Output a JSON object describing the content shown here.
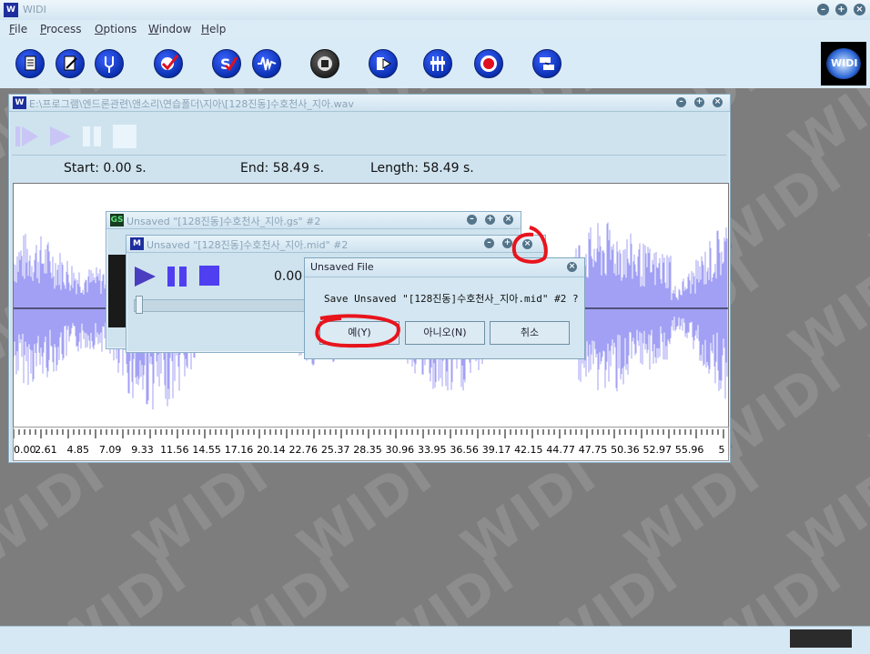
{
  "app": {
    "title": "WIDI",
    "logo_text": "WIDI"
  },
  "menu": [
    {
      "label": "File",
      "mnemonic": "F",
      "rest": "ile"
    },
    {
      "label": "Process",
      "mnemonic": "P",
      "rest": "rocess"
    },
    {
      "label": "Options",
      "mnemonic": "O",
      "rest": "ptions"
    },
    {
      "label": "Window",
      "mnemonic": "W",
      "rest": "indow"
    },
    {
      "label": "Help",
      "mnemonic": "H",
      "rest": "elp"
    }
  ],
  "toolbar_icons": [
    "new-document-icon",
    "edit-document-icon",
    "tuning-fork-icon",
    "check-disc-icon",
    "s-check-icon",
    "waveform-icon",
    "stop-circle-icon",
    "export-icon",
    "mixer-icon",
    "record-icon",
    "convert-icon"
  ],
  "wave_window": {
    "title": "E:\\프로그램\\엔드론관련\\앤소리\\연습폴더\\지아\\[128진동]수호천사_지아.wav",
    "start_label": "Start: 0.00 s.",
    "end_label": "End: 58.49 s.",
    "length_label": "Length: 58.49 s.",
    "ticks": [
      "0.00",
      "2.61",
      "4.85",
      "7.09",
      "9.33",
      "11.56",
      "14.55",
      "17.16",
      "20.14",
      "22.76",
      "25.37",
      "28.35",
      "30.96",
      "33.95",
      "36.56",
      "39.17",
      "42.15",
      "44.77",
      "47.75",
      "50.36",
      "52.97",
      "55.96",
      "5"
    ],
    "wave_color": "#7b78f0"
  },
  "gs_window": {
    "title": "Unsaved \"[128진동]수호천사_지아.gs\" #2",
    "icon_text": "GS"
  },
  "mid_window": {
    "title": "Unsaved \"[128진동]수호천사_지아.mid\" #2",
    "time": "0.00"
  },
  "dialog": {
    "title": "Unsaved File",
    "message": "Save Unsaved \"[128진동]수호천사_지아.mid\" #2 ?",
    "yes_label": "예(Y)",
    "no_label": "아니오(N)",
    "cancel_label": "취소"
  },
  "annotation_color": "#e8141c",
  "accent_color": "#0a2fb0"
}
